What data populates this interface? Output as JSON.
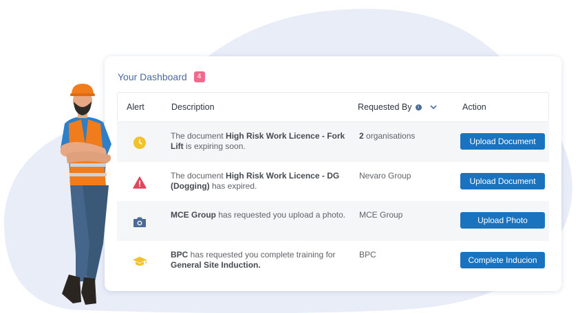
{
  "dashboard": {
    "title": "Your Dashboard",
    "badge_count": "4",
    "columns": {
      "alert": "Alert",
      "description": "Description",
      "requested_by": "Requested By",
      "action": "Action"
    },
    "rows": [
      {
        "icon": "clock-icon",
        "desc_pre": "The document ",
        "desc_bold": "High Risk Work Licence - Fork Lift",
        "desc_post": " is expiring soon.",
        "req_bold": "2",
        "req_text": " organisations",
        "action": "Upload Document"
      },
      {
        "icon": "warning-icon",
        "desc_pre": "The document ",
        "desc_bold": "High Risk Work Licence - DG (Dogging)",
        "desc_post": " has expired.",
        "req_bold": "",
        "req_text": "Nevaro Group",
        "action": "Upload Document"
      },
      {
        "icon": "camera-icon",
        "desc_pre": "",
        "desc_bold": "MCE Group",
        "desc_post": "  has requested you upload a photo.",
        "req_bold": "",
        "req_text": "MCE Group",
        "action": "Upload Photo"
      },
      {
        "icon": "graduation-cap-icon",
        "desc_pre": "",
        "desc_bold": "BPC",
        "desc_post": " has requested you complete training for ",
        "desc_bold2": "General Site Induction.",
        "req_bold": "",
        "req_text": "BPC",
        "action": "Complete Inducion"
      }
    ]
  },
  "colors": {
    "accent_button": "#1a73be",
    "title": "#4a6aa0",
    "badge": "#ef6a8c",
    "clock": "#f2c12e",
    "warning": "#e0475d",
    "camera": "#4b6b96",
    "graduation_cap": "#f2c12e",
    "background_blob": "#e9edf8"
  }
}
